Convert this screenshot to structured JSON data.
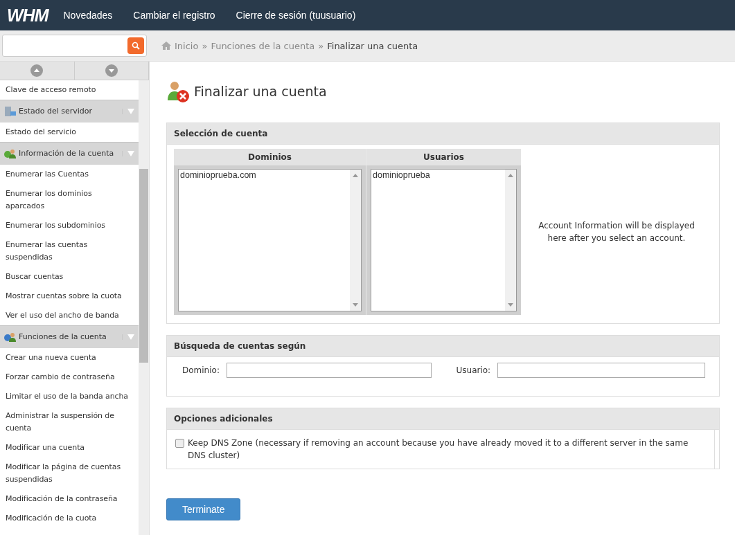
{
  "topbar": {
    "logo": "WHM",
    "links": [
      "Novedades",
      "Cambiar el registro",
      "Cierre de sesión (tuusuario)"
    ]
  },
  "breadcrumb": {
    "items": [
      "Inicio",
      "Funciones de la cuenta",
      "Finalizar una cuenta"
    ],
    "separator": "»"
  },
  "sidebar": {
    "items": [
      {
        "kind": "link",
        "label": "Clave de acceso remoto"
      },
      {
        "kind": "section",
        "label": "Estado del servidor"
      },
      {
        "kind": "link",
        "label": "Estado del servicio"
      },
      {
        "kind": "section",
        "label": "Información de la cuenta"
      },
      {
        "kind": "link",
        "label": "Enumerar las Cuentas"
      },
      {
        "kind": "link",
        "label": "Enumerar los dominios aparcados"
      },
      {
        "kind": "link",
        "label": "Enumerar los subdominios"
      },
      {
        "kind": "link",
        "label": "Enumerar las cuentas suspendidas"
      },
      {
        "kind": "link",
        "label": "Buscar cuentas"
      },
      {
        "kind": "link",
        "label": "Mostrar cuentas sobre la cuota"
      },
      {
        "kind": "link",
        "label": "Ver el uso del ancho de banda"
      },
      {
        "kind": "section",
        "label": "Funciones de la cuenta"
      },
      {
        "kind": "link",
        "label": "Crear una nueva cuenta"
      },
      {
        "kind": "link",
        "label": "Forzar cambio de contraseña"
      },
      {
        "kind": "link",
        "label": "Limitar el uso de la banda ancha"
      },
      {
        "kind": "link",
        "label": "Administrar la suspensión de cuenta"
      },
      {
        "kind": "link",
        "label": "Modificar una cuenta"
      },
      {
        "kind": "link",
        "label": "Modificar la página de cuentas suspendidas"
      },
      {
        "kind": "link",
        "label": "Modificación de la contraseña"
      },
      {
        "kind": "link",
        "label": "Modificación de la cuota"
      }
    ]
  },
  "page": {
    "title": "Finalizar una cuenta"
  },
  "selection": {
    "title": "Selección de cuenta",
    "columns": [
      "Dominios",
      "Usuarios"
    ],
    "domains": [
      "dominioprueba.com"
    ],
    "users": [
      "dominioprueba"
    ],
    "info": "Account Information will be displayed here after you select an account."
  },
  "search_panel": {
    "title": "Búsqueda de cuentas según",
    "fields": [
      {
        "label": "Dominio:"
      },
      {
        "label": "Usuario:"
      }
    ]
  },
  "options": {
    "title": "Opciones adicionales",
    "keep_dns": {
      "label": "Keep DNS Zone (necessary if removing an account because you have already moved it to a different server in the same DNS cluster)",
      "checked": false
    }
  },
  "button": "Terminate"
}
